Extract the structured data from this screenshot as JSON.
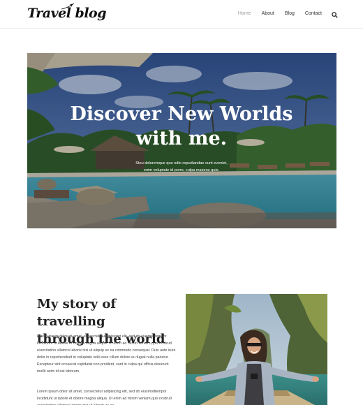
{
  "header": {
    "logo_text": "Travel blog",
    "nav": [
      {
        "label": "Home",
        "active": true
      },
      {
        "label": "About",
        "active": false
      },
      {
        "label": "Blog",
        "active": false
      },
      {
        "label": "Contact",
        "active": false
      }
    ],
    "search_icon": "search-icon"
  },
  "hero": {
    "title_line1": "Discover New Worlds",
    "title_line2": "with me.",
    "subtitle_line1": "Stou doloremque quo odio repudiandae sunt eveniet,",
    "subtitle_line2": "enim voluptate id porro, culpa maiores quis."
  },
  "story": {
    "title_line1": "My story of travelling",
    "title_line2": "through the world",
    "paragraph1": "Lorem ipsum dolor sit amet, consectetur adipisicing elit, sed do eiusmodtempor incididunt ut labore et dolore magna aliqua. Ut enim ad minim veniam,quis nostrud exercitation ullamco laboris nisi ut aliquip ex ea commodo consequat. Duis aute irure dolor in reprehenderit in voluptate velit esse cillum dolore eu fugiat nulla pariatur. Excepteur sint occaecat cupidatat non proident, sunt in culpa qui officia deserunt mollit anim id est laborum.",
    "paragraph2": "Lorem ipsum dolor sit amet, consectetur adipisicing elit, sed do eiusmodtempor incididunt ut labore et dolore magna aliqua. Ut enim ad minim veniam,quis nostrud exercitation ullamco laboris nisi ut aliquip ex ea."
  },
  "colors": {
    "accent_text": "#222222",
    "nav_active": "#999999",
    "hero_text": "#ffffff"
  }
}
